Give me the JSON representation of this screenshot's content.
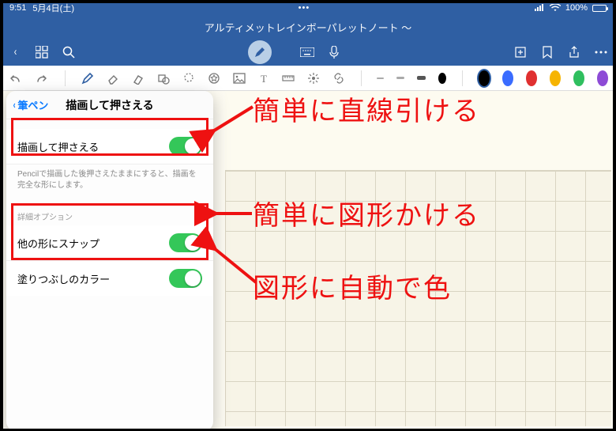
{
  "status": {
    "time": "9:51",
    "date": "5月4日(土)",
    "battery_pct": "100%",
    "wifi_icon": "wifi",
    "signal_icon": "signal"
  },
  "titlebar": {
    "doc_title": "アルティメットレインボーパレットノート 〜"
  },
  "appbar": {
    "back": "‹",
    "grid_icon": "apps",
    "search_icon": "search",
    "pen_icon": "pen",
    "keyboard_icon": "keyboard",
    "mic_icon": "mic",
    "share_icon": "share-arrow",
    "bookmark_icon": "bookmark",
    "export_icon": "export",
    "more_icon": "more"
  },
  "toolstrip": {
    "undo": "↶",
    "redo": "↷",
    "colors": [
      "#000000",
      "#3a6cff",
      "#e03030",
      "#f6b400",
      "#2fbf5f",
      "#8d4bd6"
    ]
  },
  "popover": {
    "back_label": "筆ペン",
    "title": "描画して押さえる",
    "rows": {
      "draw_hold": {
        "label": "描画して押さえる",
        "on": true
      },
      "desc": "Pencilで描画した後押さえたままにすると、描画を完全な形にします。",
      "section": "詳細オプション",
      "snap": {
        "label": "他の形にスナップ",
        "on": true
      },
      "fill": {
        "label": "塗りつぶしのカラー",
        "on": true
      }
    }
  },
  "annotations": {
    "a1": "簡単に直線引ける",
    "a2": "簡単に図形かける",
    "a3": "図形に自動で色"
  }
}
